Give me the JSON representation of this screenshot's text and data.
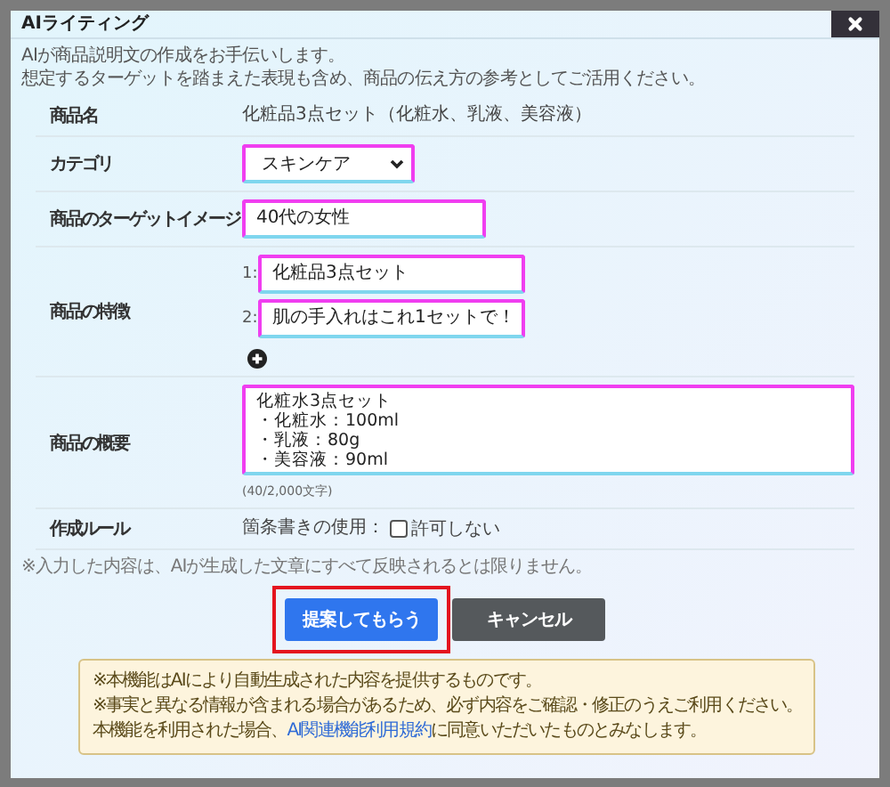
{
  "modal": {
    "title": "AIライティング"
  },
  "intro": [
    "AIが商品説明文の作成をお手伝いします。",
    "想定するターゲットを踏まえた表現も含め、商品の伝え方の参考としてご活用ください。"
  ],
  "fields": [
    {
      "kind": "text",
      "label": "商品名",
      "value": "化粧品3点セット（化粧水、乳液、美容液）"
    },
    {
      "kind": "select",
      "label": "カテゴリ",
      "value": "スキンケア"
    },
    {
      "kind": "input",
      "label": "商品のターゲットイメージ",
      "value": "40代の女性"
    },
    {
      "kind": "list",
      "label": "商品の特徴",
      "items": [
        {
          "index": "1:",
          "value": "化粧品3点セット"
        },
        {
          "index": "2:",
          "value": "肌の手入れはこれ1セットで！"
        }
      ]
    },
    {
      "kind": "textarea",
      "label": "商品の概要",
      "lines": [
        "化粧水3点セット",
        "・化粧水：100ml",
        "・乳液：80g",
        "・美容液：90ml"
      ],
      "counter": "(40/2,000文字)"
    },
    {
      "kind": "checkbox",
      "label": "作成ルール",
      "prefix": "箇条書きの使用：",
      "option": "許可しない",
      "checked": false
    }
  ],
  "note": "※入力した内容は、AIが生成した文章にすべて反映されるとは限りません。",
  "buttons": [
    {
      "kind": "primary",
      "label": "提案してもらう",
      "highlighted": true
    },
    {
      "kind": "secondary",
      "label": "キャンセル",
      "highlighted": false
    }
  ],
  "notice": {
    "lines": [
      "※本機能はAIにより自動生成された内容を提供するものです。",
      "※事実と異なる情報が含まれる場合があるため、必ず内容をご確認・修正のうえご利用ください。"
    ],
    "terms": {
      "before": "本機能を利用された場合、",
      "link": "AI関連機能利用規約",
      "after": "に同意いただいたものとみなします。"
    }
  }
}
